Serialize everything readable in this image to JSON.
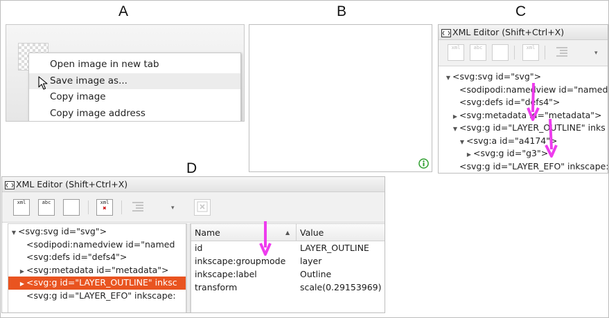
{
  "labels": {
    "a": "A",
    "b": "B",
    "c": "C",
    "d": "D"
  },
  "context_menu": {
    "items": [
      "Open image in new tab",
      "Save image as...",
      "Copy image",
      "Copy image address"
    ],
    "hover_index": 1
  },
  "xml_editor": {
    "title": "XML Editor (Shift+Ctrl+X)",
    "toolbar_buttons": [
      {
        "icon": "new-element-node-icon",
        "text": "xml"
      },
      {
        "icon": "new-text-node-icon",
        "text": "abc"
      },
      {
        "icon": "duplicate-node-icon",
        "text": ""
      },
      {
        "icon": "delete-node-icon",
        "text": "xml"
      },
      {
        "icon": "unindent-node-icon",
        "text": ""
      },
      {
        "icon": "dropdown-arrow-icon",
        "text": "▾"
      }
    ]
  },
  "panel_c_tree": [
    {
      "indent": 0,
      "toggle": "▼",
      "text": "<svg:svg id=\"svg\">"
    },
    {
      "indent": 1,
      "toggle": "",
      "text": "<sodipodi:namedview id=\"named"
    },
    {
      "indent": 1,
      "toggle": "",
      "text": "<svg:defs id=\"defs4\">"
    },
    {
      "indent": 1,
      "toggle": "▶",
      "text": "<svg:metadata id=\"metadata\">"
    },
    {
      "indent": 1,
      "toggle": "▼",
      "text": "<svg:g id=\"LAYER_OUTLINE\" inks"
    },
    {
      "indent": 2,
      "toggle": "▼",
      "text": "<svg:a id=\"a4174\">"
    },
    {
      "indent": 3,
      "toggle": "▶",
      "text": "<svg:g id=\"g3\">"
    },
    {
      "indent": 1,
      "toggle": "",
      "text": "<svg:g id=\"LAYER_EFO\" inkscape:"
    }
  ],
  "panel_d_tree": [
    {
      "indent": 0,
      "toggle": "▼",
      "text": "<svg:svg id=\"svg\">",
      "selected": false
    },
    {
      "indent": 1,
      "toggle": "",
      "text": "<sodipodi:namedview id=\"named",
      "selected": false
    },
    {
      "indent": 1,
      "toggle": "",
      "text": "<svg:defs id=\"defs4\">",
      "selected": false
    },
    {
      "indent": 1,
      "toggle": "▶",
      "text": "<svg:metadata id=\"metadata\">",
      "selected": false
    },
    {
      "indent": 1,
      "toggle": "▶",
      "text": "<svg:g id=\"LAYER_OUTLINE\" inksc",
      "selected": true
    },
    {
      "indent": 1,
      "toggle": "",
      "text": "<svg:g id=\"LAYER_EFO\" inkscape:",
      "selected": false
    }
  ],
  "attributes": {
    "header_name": "Name",
    "header_value": "Value",
    "sort_indicator": "▲",
    "rows": [
      {
        "name": "id",
        "value": "LAYER_OUTLINE"
      },
      {
        "name": "inkscape:groupmode",
        "value": "layer"
      },
      {
        "name": "inkscape:label",
        "value": "Outline"
      },
      {
        "name": "transform",
        "value": "scale(0.29153969)"
      }
    ]
  },
  "colors": {
    "selection": "#e95420",
    "arrow": "#ee3cee",
    "info_icon": "#2e9e2e"
  }
}
